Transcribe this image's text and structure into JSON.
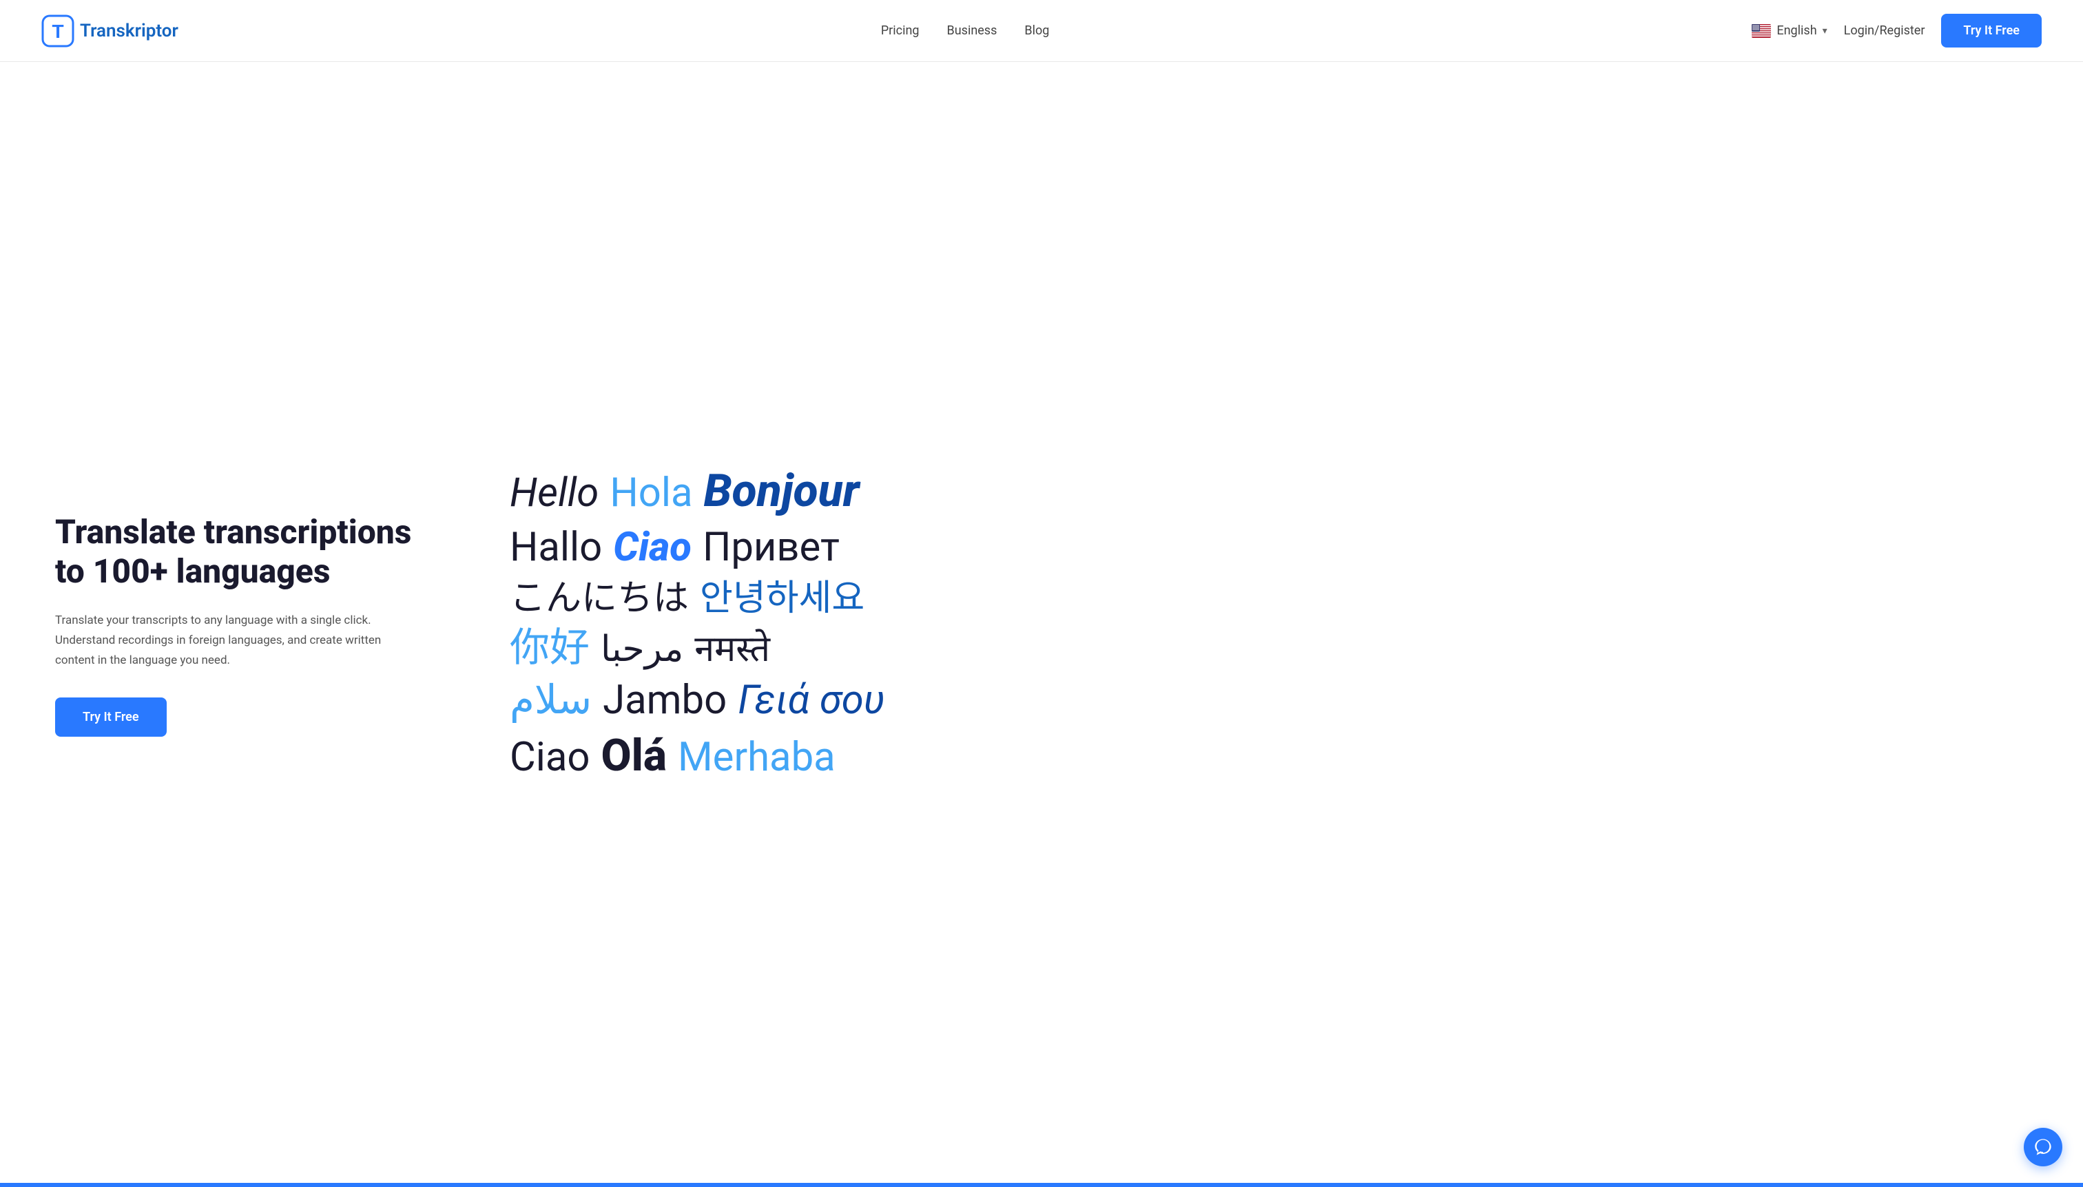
{
  "brand": {
    "name": "Transkriptor",
    "logo_letter": "T"
  },
  "nav": {
    "links": [
      {
        "label": "Pricing",
        "href": "#"
      },
      {
        "label": "Business",
        "href": "#"
      },
      {
        "label": "Blog",
        "href": "#"
      }
    ],
    "language": "English",
    "login_label": "Login/Register",
    "try_free_label": "Try It Free"
  },
  "hero": {
    "title": "Translate transcriptions to 100+ languages",
    "description": "Translate your transcripts to any language with a single click. Understand recordings in foreign languages, and create written content in the language you need.",
    "cta_label": "Try It Free"
  },
  "language_cloud": {
    "rows": [
      [
        {
          "text": "Hello",
          "style": "italic dark"
        },
        {
          "text": "Hola",
          "style": "blue-light"
        },
        {
          "text": "Bonjour",
          "style": "italic bold blue-dark"
        }
      ],
      [
        {
          "text": "Hallo",
          "style": "dark"
        },
        {
          "text": "Ciao",
          "style": "italic bold blue-mid"
        },
        {
          "text": "Привет",
          "style": "dark"
        }
      ],
      [
        {
          "text": "こんにちは",
          "style": "dark sm"
        },
        {
          "text": "안녕하세요",
          "style": "blue-mid"
        }
      ],
      [
        {
          "text": "你好",
          "style": "blue-light"
        },
        {
          "text": "مرحبا",
          "style": "dark"
        },
        {
          "text": "नमस्ते",
          "style": "dark sm"
        }
      ],
      [
        {
          "text": "سلام",
          "style": "blue-light"
        },
        {
          "text": "Jambo",
          "style": "dark"
        },
        {
          "text": "Γειά σου",
          "style": "italic blue-dark"
        }
      ],
      [
        {
          "text": "Ciao",
          "style": "dark"
        },
        {
          "text": "Olá",
          "style": "bold dark"
        },
        {
          "text": "Merhaba",
          "style": "blue-light"
        }
      ]
    ]
  },
  "chat": {
    "icon": "chat-icon"
  }
}
